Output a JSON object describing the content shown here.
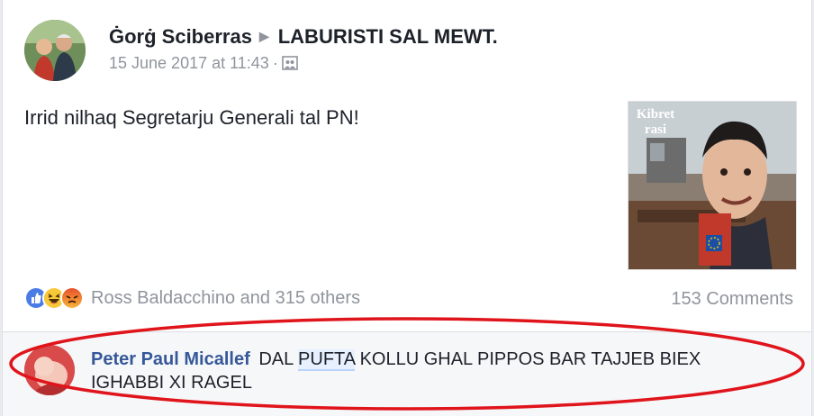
{
  "post": {
    "author": "Ġorġ Sciberras",
    "group": "LABURISTI SAL MEWT.",
    "timestamp": "15 June 2017 at 11:43",
    "separator": "·",
    "text": "Irrid nilhaq Segretarju Generali tal PN!",
    "photo_caption_line1": "Kibret",
    "photo_caption_line2": "rasi"
  },
  "reactions": {
    "icons": [
      "like-icon",
      "haha-icon",
      "angry-icon"
    ],
    "summary": "Ross Baldacchino and 315 others",
    "comments_count": "153 Comments"
  },
  "comment": {
    "author": "Peter Paul Micallef",
    "text_before": "DAL",
    "highlighted": "PUFTA",
    "text_after": "KOLLU GHAL PIPPOS BAR TAJJEB BIEX IGHABBI XI RAGEL"
  },
  "colors": {
    "link": "#365899",
    "meta": "#90949c",
    "annotation_oval": "#e0141b"
  }
}
